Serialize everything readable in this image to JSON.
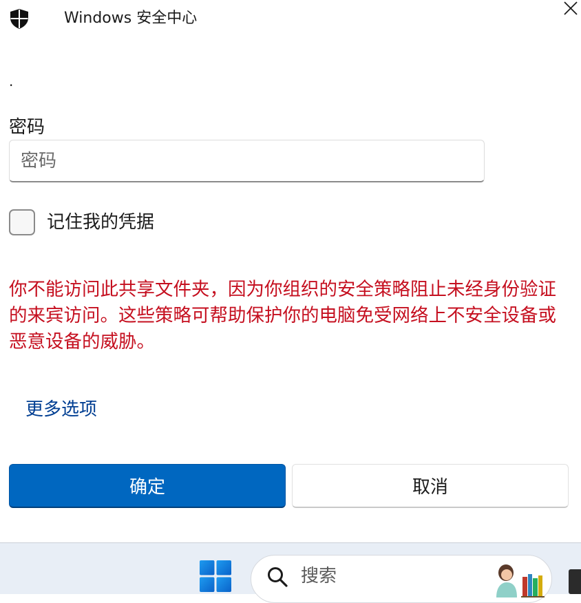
{
  "window": {
    "title": "Windows 安全中心",
    "close_icon": "close-icon",
    "shield_icon": "shield-icon"
  },
  "dialog": {
    "dot_text": ".",
    "password_label": "密码",
    "password_input": {
      "value": "",
      "placeholder": "密码"
    },
    "remember_label": "记住我的凭据",
    "remember_checked": false,
    "error_message": "你不能访问此共享文件夹，因为你组织的安全策略阻止未经身份验证的来宾访问。这些策略可帮助保护你的电脑免受网络上不安全设备或恶意设备的威胁。",
    "more_options": "更多选项",
    "ok_label": "确定",
    "cancel_label": "取消"
  },
  "taskbar": {
    "start_icon": "windows-start-icon",
    "search_placeholder": "搜索",
    "search_icon": "search-icon"
  },
  "colors": {
    "accent": "#0067c0",
    "error": "#c50f1f",
    "link": "#003e92",
    "taskbar": "#e8eef6"
  }
}
